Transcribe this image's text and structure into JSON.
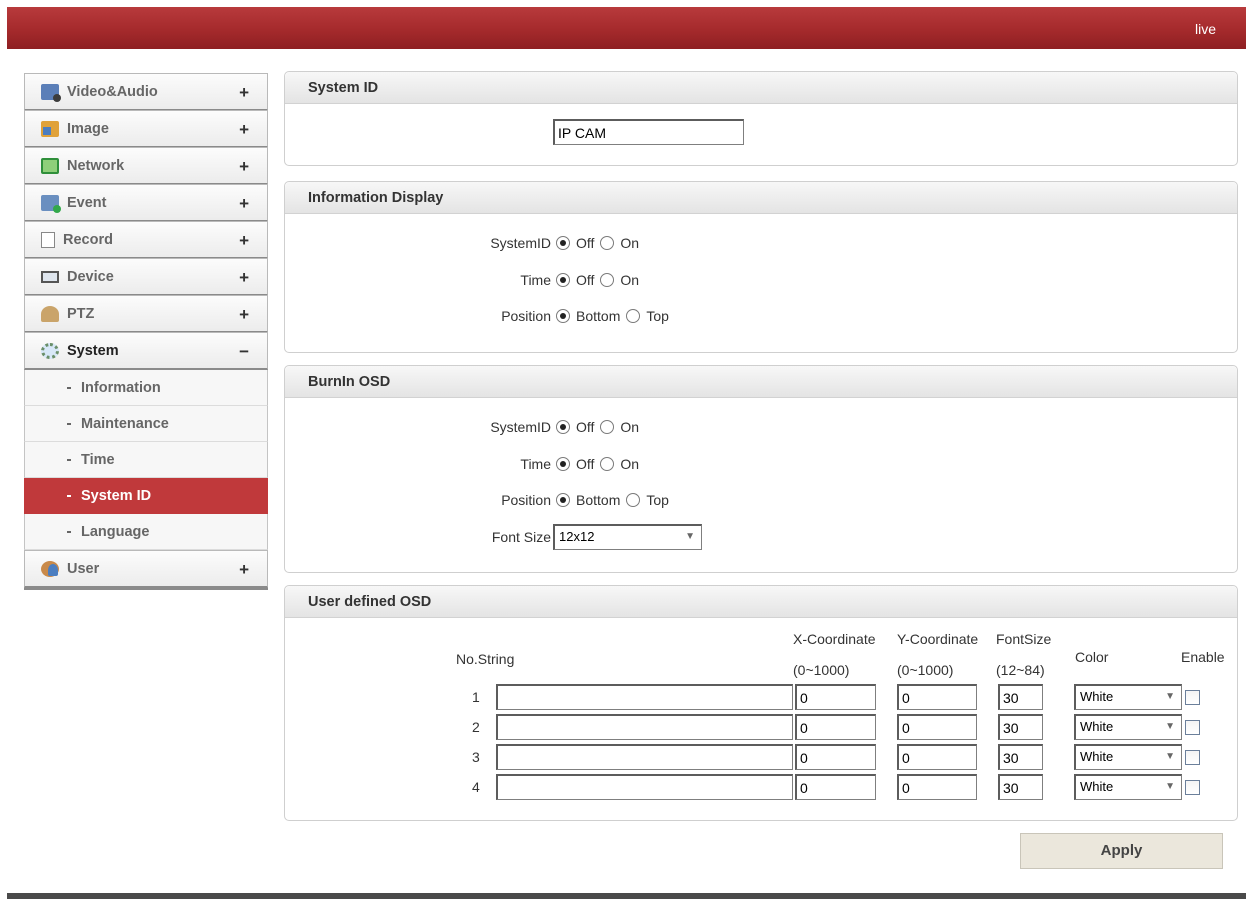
{
  "header": {
    "live_label": "live"
  },
  "sidebar": {
    "items": [
      {
        "label": "Video&Audio",
        "toggle": "+"
      },
      {
        "label": "Image",
        "toggle": "+"
      },
      {
        "label": "Network",
        "toggle": "+"
      },
      {
        "label": "Event",
        "toggle": "+"
      },
      {
        "label": "Record",
        "toggle": "+"
      },
      {
        "label": "Device",
        "toggle": "+"
      },
      {
        "label": "PTZ",
        "toggle": "+"
      },
      {
        "label": "System",
        "toggle": "−"
      },
      {
        "label": "User",
        "toggle": "+"
      }
    ],
    "system_sub": [
      "Information",
      "Maintenance",
      "Time",
      "System ID",
      "Language"
    ],
    "active_sub": "System ID"
  },
  "system_id_panel": {
    "title": "System ID",
    "label": "System ID",
    "value": "IP CAM"
  },
  "info_display_panel": {
    "title": "Information Display",
    "systemid_label": "SystemID",
    "time_label": "Time",
    "position_label": "Position",
    "off": "Off",
    "on": "On",
    "bottom": "Bottom",
    "top": "Top",
    "systemid_value": "Off",
    "time_value": "Off",
    "position_value": "Bottom"
  },
  "burnin_panel": {
    "title": "BurnIn OSD",
    "systemid_label": "SystemID",
    "time_label": "Time",
    "position_label": "Position",
    "font_size_label": "Font Size",
    "off": "Off",
    "on": "On",
    "bottom": "Bottom",
    "top": "Top",
    "systemid_value": "Off",
    "time_value": "Off",
    "position_value": "Bottom",
    "font_size_value": "12x12"
  },
  "user_osd_panel": {
    "title": "User defined OSD",
    "col_no_string": "No.String",
    "col_x": "X-Coordinate",
    "col_x_range": "(0~1000)",
    "col_y": "Y-Coordinate",
    "col_y_range": "(0~1000)",
    "col_fontsize": "FontSize",
    "col_fontsize_range": "(12~84)",
    "col_color": "Color",
    "col_enable": "Enable",
    "rows": [
      {
        "no": "1",
        "string": "",
        "x": "0",
        "y": "0",
        "font": "30",
        "color": "White",
        "enabled": false
      },
      {
        "no": "2",
        "string": "",
        "x": "0",
        "y": "0",
        "font": "30",
        "color": "White",
        "enabled": false
      },
      {
        "no": "3",
        "string": "",
        "x": "0",
        "y": "0",
        "font": "30",
        "color": "White",
        "enabled": false
      },
      {
        "no": "4",
        "string": "",
        "x": "0",
        "y": "0",
        "font": "30",
        "color": "White",
        "enabled": false
      }
    ]
  },
  "actions": {
    "apply_label": "Apply"
  }
}
